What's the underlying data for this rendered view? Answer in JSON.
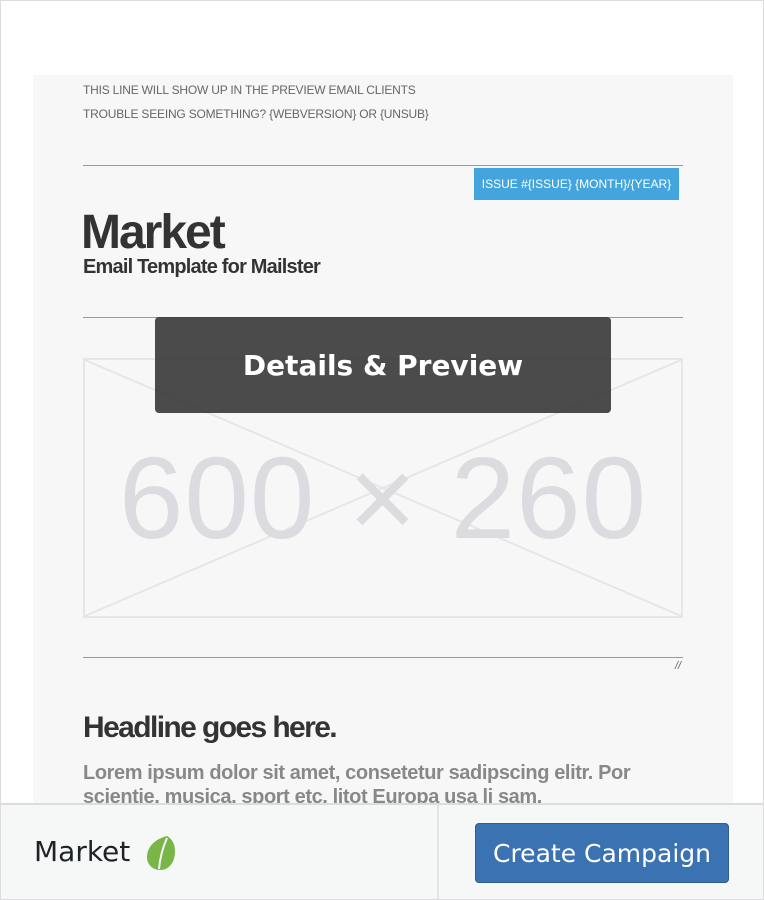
{
  "email_preview": {
    "preheader_line1": "THIS LINE WILL SHOW UP IN THE PREVIEW EMAIL CLIENTS",
    "preheader_line2": "TROUBLE SEEING SOMETHING? {WEBVERSION} OR {UNSUB}",
    "issue_badge": "ISSUE #{ISSUE} {MONTH}/{YEAR}",
    "brand_title": "Market",
    "brand_subtitle": "Email Template for Mailster",
    "placeholder_dimensions": "600 × 260",
    "end_mark": "//",
    "headline": "Headline goes here.",
    "body_text": "Lorem ipsum dolor sit amet, consetetur sadipscing elitr. Por scientie, musica, sport etc, litot Europa usa li sam."
  },
  "overlay": {
    "details_label": "Details & Preview"
  },
  "footer": {
    "template_name": "Market",
    "create_label": "Create Campaign",
    "icon": "leaf-icon"
  },
  "colors": {
    "accent": "#44a4dd",
    "primary_button": "#3b72b1",
    "leaf": "#7ab547"
  }
}
